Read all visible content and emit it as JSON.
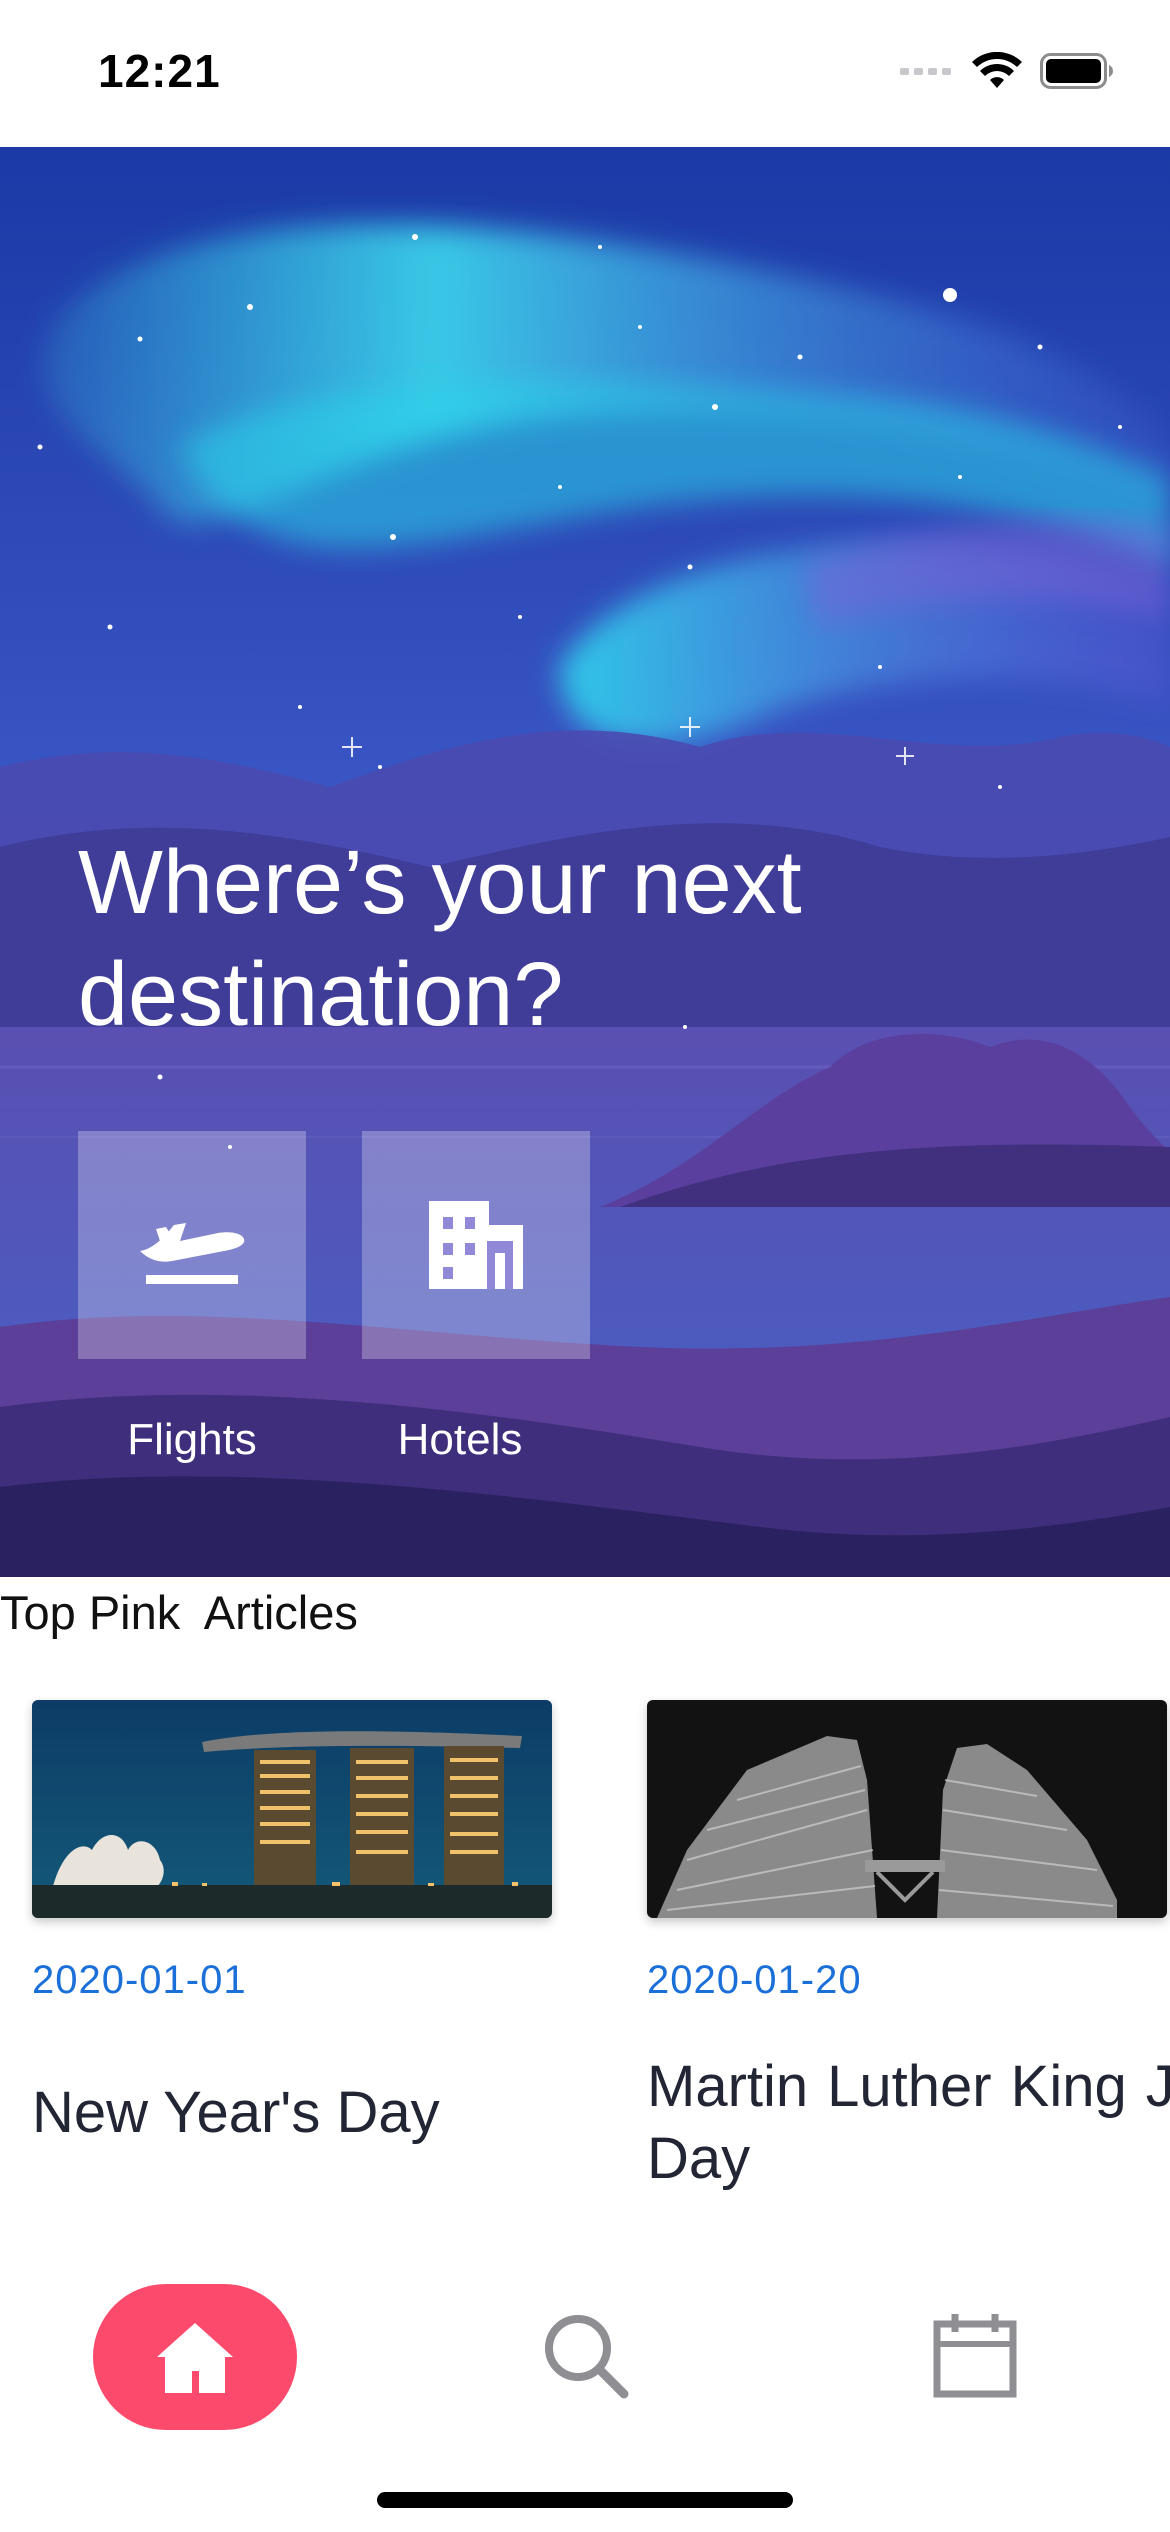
{
  "status_bar": {
    "time": "12:21",
    "icons": [
      "cellular-signal-icon",
      "wifi-icon",
      "battery-icon"
    ]
  },
  "hero": {
    "title": "Where’s your next destination?",
    "services": [
      {
        "label": "Flights",
        "icon": "airplane-takeoff-icon"
      },
      {
        "label": "Hotels",
        "icon": "hotel-building-icon"
      }
    ]
  },
  "articles": {
    "section_title": "Top Pink  Articles",
    "items": [
      {
        "date": "2020-01-01",
        "title": "New Year's Day",
        "image": "night-skyline-hotel-photo"
      },
      {
        "date": "2020-01-20",
        "title": "Martin Luther King Jr. Day",
        "image": "twin-towers-night-photo"
      }
    ]
  },
  "tab_bar": {
    "tabs": [
      {
        "name": "home",
        "icon": "home-icon",
        "active": true
      },
      {
        "name": "search",
        "icon": "search-icon",
        "active": false
      },
      {
        "name": "calendar",
        "icon": "calendar-icon",
        "active": false
      }
    ],
    "active_color": "#fb4a6b",
    "inactive_color": "#8e8e93"
  },
  "colors": {
    "date_text": "#1a6fd8",
    "hero_sky_top": "#1f3fa8",
    "aurora": "#36e0f0"
  }
}
